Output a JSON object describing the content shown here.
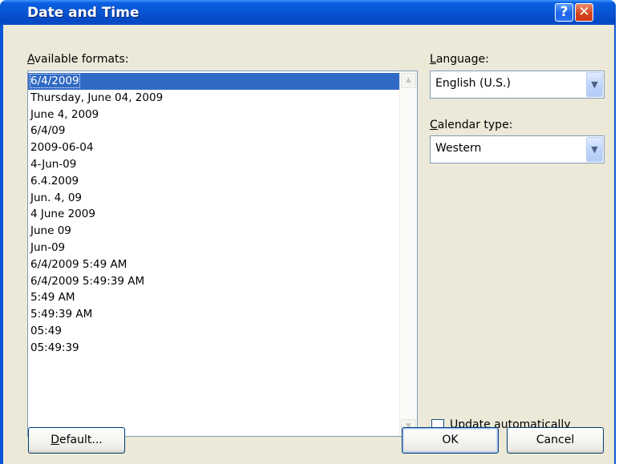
{
  "window": {
    "title": "Date and Time",
    "help_glyph": "?",
    "close_glyph": "✕"
  },
  "formats": {
    "label_access_key": "A",
    "label_rest": "vailable formats:",
    "selected_index": 0,
    "items": [
      "6/4/2009",
      "Thursday, June 04, 2009",
      "June 4, 2009",
      "6/4/09",
      "2009-06-04",
      "4-Jun-09",
      "6.4.2009",
      "Jun. 4, 09",
      "4 June 2009",
      "June 09",
      "Jun-09",
      "6/4/2009 5:49 AM",
      "6/4/2009 5:49:39 AM",
      "5:49 AM",
      "5:49:39 AM",
      "05:49",
      "05:49:39"
    ]
  },
  "language": {
    "label_access_key": "L",
    "label_rest": "anguage:",
    "value": "English (U.S.)"
  },
  "calendar": {
    "label_access_key": "C",
    "label_rest": "alendar type:",
    "value": "Western"
  },
  "update_auto": {
    "label_access_key": "U",
    "label_rest": "pdate automatically",
    "checked": false
  },
  "buttons": {
    "default_access_key": "D",
    "default_rest": "efault...",
    "ok": "OK",
    "cancel": "Cancel"
  },
  "colors": {
    "title_bar": "#0853d0",
    "dialog_bg": "#ece9d8",
    "selection": "#316ac5"
  }
}
